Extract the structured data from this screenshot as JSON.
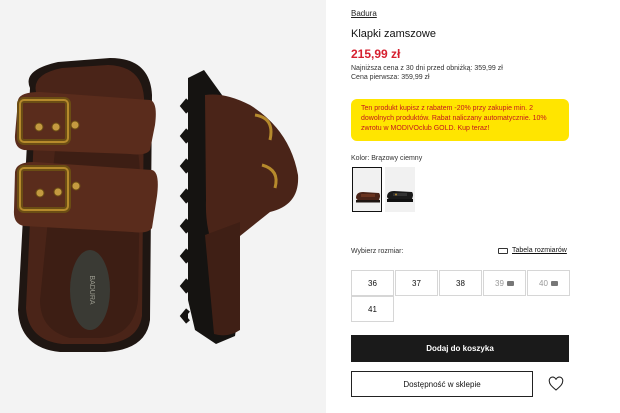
{
  "product": {
    "brand": "Badura",
    "title": "Klapki zamszowe",
    "price": "215,99 zł",
    "lowest_price": "Najniższa cena z 30 dni przed obniżką: 359,99 zł",
    "first_price": "Cena pierwsza: 359,99 zł",
    "insole_logo": "BADURA"
  },
  "promo": {
    "line1": "Ten produkt kupisz z rabatem -20% przy zakupie min. 2",
    "line2": "dowolnych produktów. Rabat naliczany automatycznie. 10%",
    "line3": "zwrotu w MODIVOclub GOLD. Kup teraz!",
    "background": "#ffe500",
    "text_color": "#c3161f"
  },
  "color": {
    "label": "Kolor: Brązowy ciemny",
    "swatches": [
      "brown-sandal",
      "black-sandal"
    ]
  },
  "sizes": {
    "label": "Wybierz rozmiar:",
    "table_link": "Tabela rozmiarów",
    "options": [
      {
        "label": "36",
        "available": true
      },
      {
        "label": "37",
        "available": true
      },
      {
        "label": "38",
        "available": true
      },
      {
        "label": "39",
        "available": false
      },
      {
        "label": "40",
        "available": false
      },
      {
        "label": "41",
        "available": true
      }
    ]
  },
  "actions": {
    "add_to_cart": "Dodaj do koszyka",
    "store_availability": "Dostępność w sklepie",
    "wishlist_icon": "heart-icon"
  },
  "colors": {
    "price": "#d6202f",
    "button": "#1a1a1a",
    "suede": "#4a2418"
  }
}
